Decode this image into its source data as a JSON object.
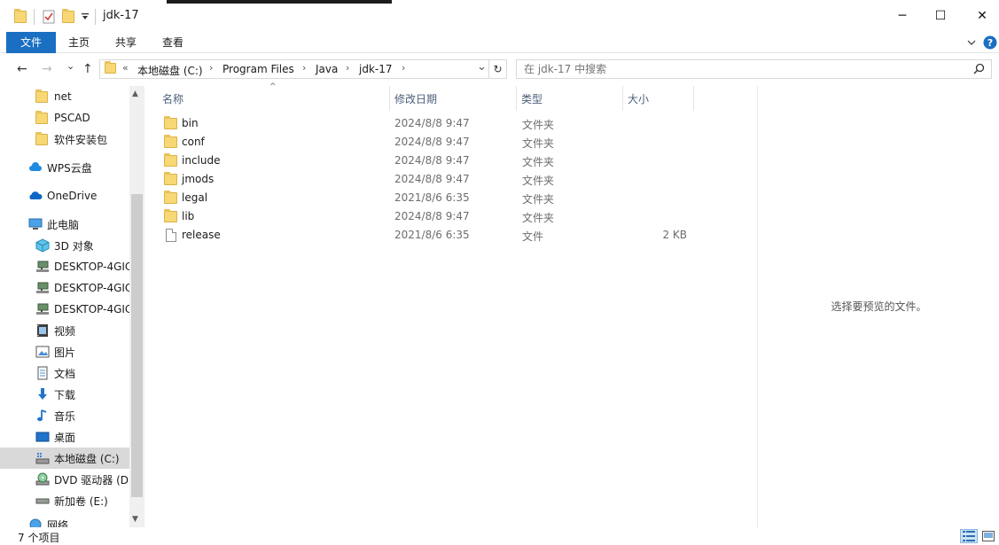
{
  "window": {
    "title": "jdk-17",
    "controls": {
      "minimize": "─",
      "maximize": "☐",
      "close": "✕"
    }
  },
  "ribbon": {
    "tabs": [
      {
        "label": "文件",
        "active": true
      },
      {
        "label": "主页"
      },
      {
        "label": "共享"
      },
      {
        "label": "查看"
      }
    ],
    "expand_icon": "chevron-down-icon",
    "help_icon": "help-icon"
  },
  "address": {
    "overflow": "«",
    "crumbs": [
      "本地磁盘 (C:)",
      "Program Files",
      "Java",
      "jdk-17"
    ],
    "separator": "›",
    "dropdown": "⌄",
    "refresh": "↻"
  },
  "nav_buttons": {
    "back": "←",
    "forward": "→",
    "recent": "⌄",
    "up": "↑"
  },
  "search": {
    "placeholder": "在 jdk-17 中搜索",
    "value": ""
  },
  "sidebar": {
    "items": [
      {
        "label": "net",
        "icon": "folder-icon"
      },
      {
        "label": "PSCAD",
        "icon": "folder-icon"
      },
      {
        "label": "软件安装包",
        "icon": "folder-icon"
      },
      {
        "label": "WPS云盘",
        "icon": "wps-cloud-icon"
      },
      {
        "label": "OneDrive",
        "icon": "onedrive-icon"
      },
      {
        "label": "此电脑",
        "icon": "computer-icon"
      },
      {
        "label": "3D 对象",
        "icon": "3d-objects-icon"
      },
      {
        "label": "DESKTOP-4GIC",
        "icon": "network-drive-icon"
      },
      {
        "label": "DESKTOP-4GIC",
        "icon": "network-drive-icon"
      },
      {
        "label": "DESKTOP-4GIC",
        "icon": "network-drive-icon"
      },
      {
        "label": "视频",
        "icon": "video-icon"
      },
      {
        "label": "图片",
        "icon": "pictures-icon"
      },
      {
        "label": "文档",
        "icon": "documents-icon"
      },
      {
        "label": "下载",
        "icon": "downloads-icon"
      },
      {
        "label": "音乐",
        "icon": "music-icon"
      },
      {
        "label": "桌面",
        "icon": "desktop-icon"
      },
      {
        "label": "本地磁盘 (C:)",
        "icon": "local-disk-icon",
        "selected": true
      },
      {
        "label": "DVD 驱动器 (D:",
        "icon": "dvd-drive-icon"
      },
      {
        "label": "新加卷 (E:)",
        "icon": "drive-icon"
      },
      {
        "label": "网络",
        "icon": "network-icon"
      }
    ]
  },
  "columns": {
    "name": "名称",
    "date": "修改日期",
    "type": "类型",
    "size": "大小"
  },
  "files": [
    {
      "name": "bin",
      "date": "2024/8/8 9:47",
      "type": "文件夹",
      "size": "",
      "kind": "folder"
    },
    {
      "name": "conf",
      "date": "2024/8/8 9:47",
      "type": "文件夹",
      "size": "",
      "kind": "folder"
    },
    {
      "name": "include",
      "date": "2024/8/8 9:47",
      "type": "文件夹",
      "size": "",
      "kind": "folder"
    },
    {
      "name": "jmods",
      "date": "2024/8/8 9:47",
      "type": "文件夹",
      "size": "",
      "kind": "folder"
    },
    {
      "name": "legal",
      "date": "2021/8/6 6:35",
      "type": "文件夹",
      "size": "",
      "kind": "folder"
    },
    {
      "name": "lib",
      "date": "2024/8/8 9:47",
      "type": "文件夹",
      "size": "",
      "kind": "folder"
    },
    {
      "name": "release",
      "date": "2021/8/6 6:35",
      "type": "文件",
      "size": "2 KB",
      "kind": "file"
    }
  ],
  "preview": {
    "message": "选择要预览的文件。"
  },
  "status": {
    "count": "7 个项目"
  },
  "colors": {
    "accent": "#1a6fc2",
    "folder": "#f8d775",
    "selected": "#d9d9d9",
    "header_text": "#4c607a"
  }
}
